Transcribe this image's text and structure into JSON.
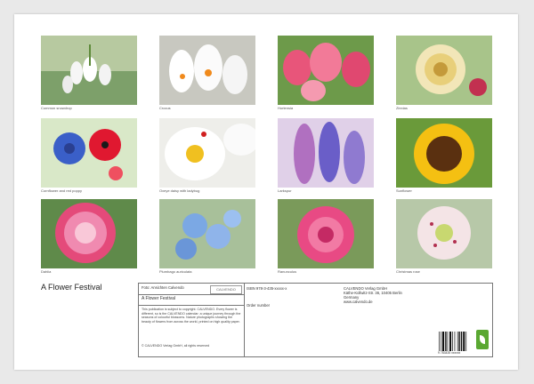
{
  "calendar": {
    "title": "A Flower Festival"
  },
  "photos": [
    {
      "caption": "Common snowdrop",
      "kind": "snowdrop"
    },
    {
      "caption": "Crocus",
      "kind": "crocus"
    },
    {
      "caption": "Hortensia",
      "kind": "tulips"
    },
    {
      "caption": "Zinnias",
      "kind": "zinnia"
    },
    {
      "caption": "Cornflower and red poppy",
      "kind": "cornflower"
    },
    {
      "caption": "Oxeye daisy with ladybug",
      "kind": "daisy"
    },
    {
      "caption": "Larkspur",
      "kind": "larkspur"
    },
    {
      "caption": "Sunflower",
      "kind": "sunflower"
    },
    {
      "caption": "Dahlia",
      "kind": "dahlia"
    },
    {
      "caption": "Plumbago auriculata",
      "kind": "plumbago"
    },
    {
      "caption": "Ranunculus",
      "kind": "ranunculus"
    },
    {
      "caption": "Christmas rose",
      "kind": "hellebore"
    }
  ],
  "info": {
    "cover_label": "Foto: Ansichten Calvendo",
    "logo": "CALVENDO",
    "subtitle": "A Flower Festival",
    "description": "This publication is subject to copyright. CALVENDO. Every flower is different, so is the CALVENDO calendar: a unique journey through the seasons of colourful blossoms. Nature photographs showing the beauty of flowers from across the world, printed on high quality paper.",
    "copyright": "© CALVENDO Verlag GmbH, all rights reserved",
    "isbn": "ISBN 978-3-435-xxxxx-x",
    "publisher_name": "CALVENDO Verlag GmbH",
    "publisher_address": "Käthe-Kollwitz-Str. 36, 10405 Berlin",
    "publisher_country": "Germany",
    "publisher_contact": "www.calvendo.de",
    "order_label": "Order number",
    "barcode_number": "9 783435 xxxxxx"
  },
  "colors": {
    "page": "#ffffff",
    "background": "#e9e9e9",
    "border": "#777777",
    "eco_badge": "#5aa832"
  }
}
